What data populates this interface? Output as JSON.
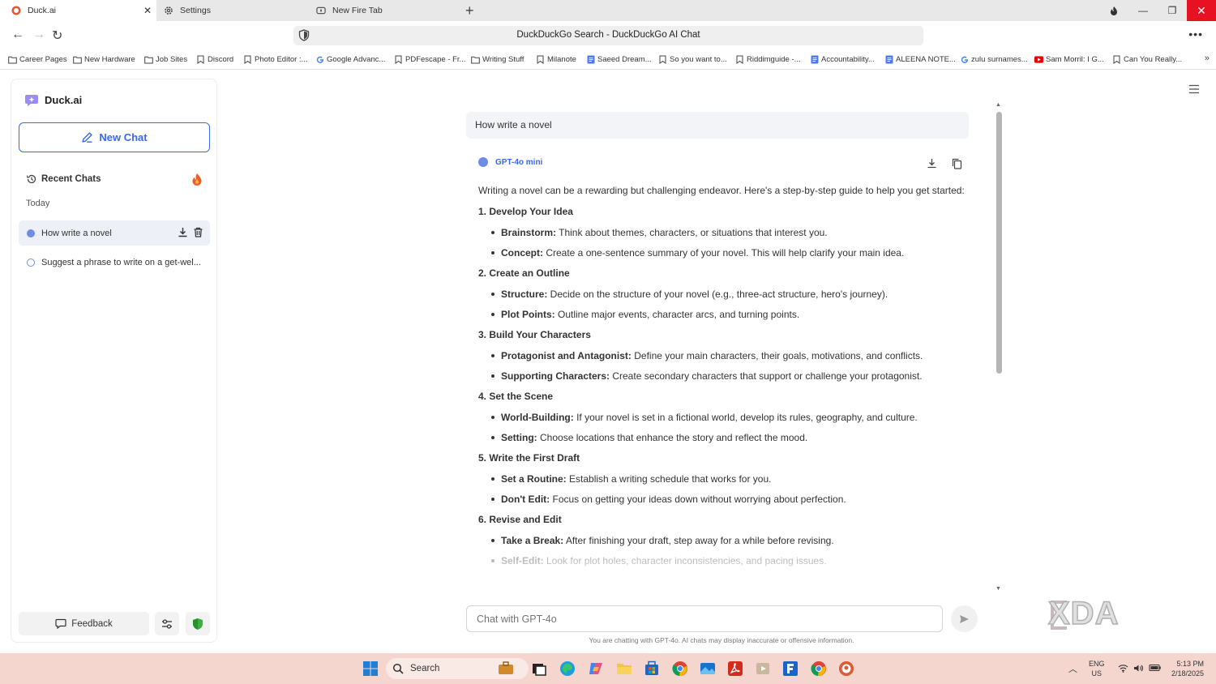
{
  "browser": {
    "tabs": [
      {
        "label": "Duck.ai",
        "icon": "duckduckgo-icon",
        "active": true
      },
      {
        "label": "Settings",
        "icon": "gear-icon",
        "active": false
      },
      {
        "label": "New Fire Tab",
        "icon": "fire-tab-icon",
        "active": false
      }
    ],
    "url_title": "DuckDuckGo Search - DuckDuckGo AI Chat",
    "bookmarks": [
      {
        "label": "Career Pages",
        "icon": "folder-icon"
      },
      {
        "label": "New Hardware",
        "icon": "folder-icon"
      },
      {
        "label": "Job Sites",
        "icon": "folder-icon"
      },
      {
        "label": "Discord",
        "icon": "bookmark-icon"
      },
      {
        "label": "Photo Editor :...",
        "icon": "bookmark-icon"
      },
      {
        "label": "Google Advanc...",
        "icon": "google-icon"
      },
      {
        "label": "PDFescape - Fr...",
        "icon": "bookmark-icon"
      },
      {
        "label": "Writing Stuff",
        "icon": "folder-icon"
      },
      {
        "label": "Milanote",
        "icon": "bookmark-icon"
      },
      {
        "label": "Saeed Dream...",
        "icon": "docs-icon"
      },
      {
        "label": "So you want to...",
        "icon": "bookmark-icon"
      },
      {
        "label": "Riddimguide -...",
        "icon": "bookmark-icon"
      },
      {
        "label": "Accountability...",
        "icon": "docs-icon"
      },
      {
        "label": "ALEENA NOTE...",
        "icon": "docs-icon"
      },
      {
        "label": "zulu surnames...",
        "icon": "google-icon"
      },
      {
        "label": "Sam Morril: I G...",
        "icon": "youtube-icon"
      },
      {
        "label": "Can You Really...",
        "icon": "bookmark-icon"
      }
    ]
  },
  "sidebar": {
    "brand": "Duck.ai",
    "new_chat": "New Chat",
    "recent_chats": "Recent Chats",
    "today": "Today",
    "chats": [
      {
        "label": "How write a novel",
        "active": true
      },
      {
        "label": "Suggest a phrase to write on a get-wel...",
        "active": false
      }
    ],
    "feedback": "Feedback"
  },
  "main": {
    "user_message": "How write a novel",
    "model": "GPT-4o mini",
    "intro": "Writing a novel can be a rewarding but challenging endeavor. Here's a step-by-step guide to help you get started:",
    "sections": [
      {
        "title": "1. Develop Your Idea",
        "bullets": [
          {
            "term": "Brainstorm:",
            "text": " Think about themes, characters, or situations that interest you."
          },
          {
            "term": "Concept:",
            "text": " Create a one-sentence summary of your novel. This will help clarify your main idea."
          }
        ]
      },
      {
        "title": "2. Create an Outline",
        "bullets": [
          {
            "term": "Structure:",
            "text": " Decide on the structure of your novel (e.g., three-act structure, hero's journey)."
          },
          {
            "term": "Plot Points:",
            "text": " Outline major events, character arcs, and turning points."
          }
        ]
      },
      {
        "title": "3. Build Your Characters",
        "bullets": [
          {
            "term": "Protagonist and Antagonist:",
            "text": " Define your main characters, their goals, motivations, and conflicts."
          },
          {
            "term": "Supporting Characters:",
            "text": " Create secondary characters that support or challenge your protagonist."
          }
        ]
      },
      {
        "title": "4. Set the Scene",
        "bullets": [
          {
            "term": "World-Building:",
            "text": " If your novel is set in a fictional world, develop its rules, geography, and culture."
          },
          {
            "term": "Setting:",
            "text": " Choose locations that enhance the story and reflect the mood."
          }
        ]
      },
      {
        "title": "5. Write the First Draft",
        "bullets": [
          {
            "term": "Set a Routine:",
            "text": " Establish a writing schedule that works for you."
          },
          {
            "term": "Don't Edit:",
            "text": " Focus on getting your ideas down without worrying about perfection."
          }
        ]
      },
      {
        "title": "6. Revise and Edit",
        "bullets": [
          {
            "term": "Take a Break:",
            "text": " After finishing your draft, step away for a while before revising."
          },
          {
            "term": "Self-Edit:",
            "text": " Look for plot holes, character inconsistencies, and pacing issues."
          }
        ]
      }
    ],
    "input_placeholder": "Chat with GPT-4o",
    "disclaimer": "You are chatting with GPT-4o. AI chats may display inaccurate or offensive information."
  },
  "watermark": "XDA",
  "taskbar": {
    "search": "Search",
    "lang_1": "ENG",
    "lang_2": "US",
    "time": "5:13 PM",
    "date": "2/18/2025"
  },
  "colors": {
    "accent": "#3969ef",
    "dot": "#6d8de6",
    "taskbar": "#f4d6cf",
    "close": "#e81123"
  }
}
